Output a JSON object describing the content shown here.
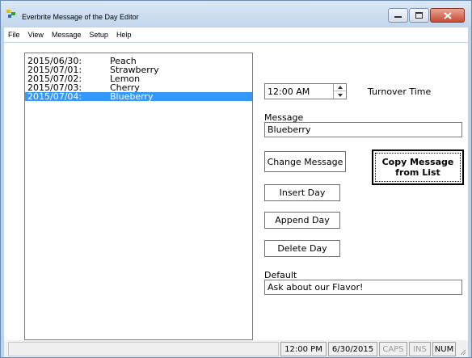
{
  "window": {
    "title": "Everbrite Message of the Day Editor",
    "close_color": "#c74b32"
  },
  "menu": [
    "File",
    "View",
    "Message",
    "Setup",
    "Help"
  ],
  "list": {
    "items": [
      {
        "date": "2015/06/30:",
        "message": "Peach"
      },
      {
        "date": "2015/07/01:",
        "message": "Strawberry"
      },
      {
        "date": "2015/07/02:",
        "message": "Lemon"
      },
      {
        "date": "2015/07/03:",
        "message": "Cherry"
      },
      {
        "date": "2015/07/04:",
        "message": "Blueberry"
      }
    ],
    "selected_index": 4,
    "selection_color": "#3399ff"
  },
  "turnover": {
    "value": "12:00 AM",
    "label": "Turnover Time"
  },
  "message": {
    "label": "Message",
    "value": "Blueberry"
  },
  "buttons": {
    "change_message": "Change Message",
    "copy_message_line1": "Copy Message",
    "copy_message_line2": "from List",
    "insert_day": "Insert Day",
    "append_day": "Append Day",
    "delete_day": "Delete Day"
  },
  "default": {
    "label": "Default",
    "value": "Ask about our Flavor!"
  },
  "status": {
    "time": "12:00 PM",
    "date": "6/30/2015",
    "caps": "CAPS",
    "ins": "INS",
    "num": "NUM"
  }
}
